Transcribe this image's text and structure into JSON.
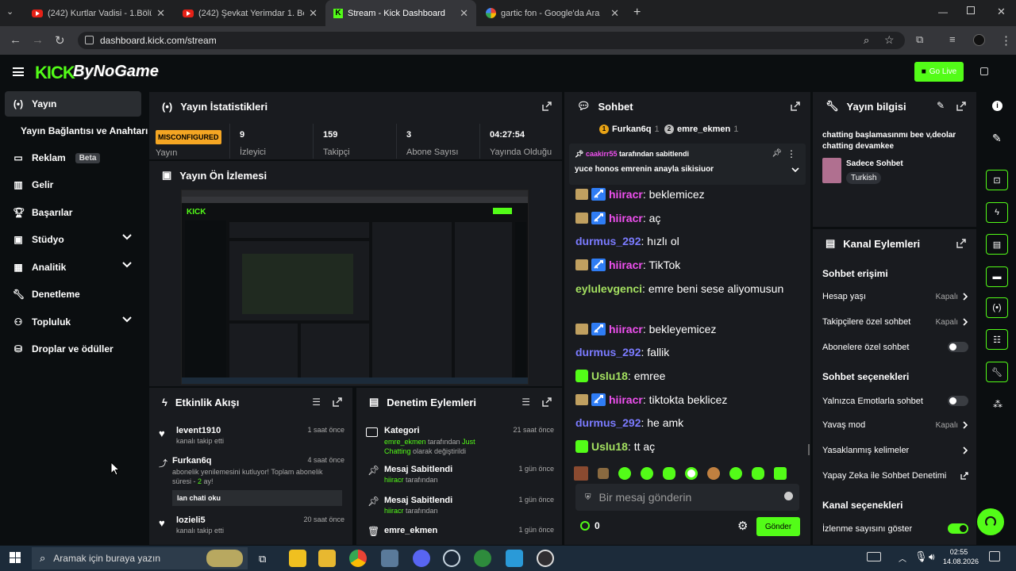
{
  "browser": {
    "tabs": [
      {
        "title": "(242) Kurtlar Vadisi - 1.Bölüm /",
        "icon": "youtube-icon"
      },
      {
        "title": "(242) Şevkat Yerimdar 1. Bölüm",
        "icon": "youtube-icon"
      },
      {
        "title": "Stream - Kick Dashboard",
        "icon": "kick-icon"
      },
      {
        "title": "gartic fon - Google'da Ara",
        "icon": "google-icon"
      }
    ],
    "url": "dashboard.kick.com/stream"
  },
  "header": {
    "logo": "KICK",
    "channel_logo_text": "ByNoGame",
    "go_live": "Go Live"
  },
  "sidebar": {
    "items": [
      {
        "label": "Yayın",
        "icon": "broadcast-icon"
      },
      {
        "label": "Yayın Bağlantısı ve Anahtarı",
        "icon": ""
      },
      {
        "label": "Reklam",
        "icon": "ad-icon",
        "badge": "Beta"
      },
      {
        "label": "Gelir",
        "icon": "revenue-icon"
      },
      {
        "label": "Başarılar",
        "icon": "trophy-icon"
      },
      {
        "label": "Stüdyo",
        "icon": "studio-icon"
      },
      {
        "label": "Analitik",
        "icon": "analytics-icon"
      },
      {
        "label": "Denetleme",
        "icon": "wrench-icon"
      },
      {
        "label": "Topluluk",
        "icon": "community-icon"
      },
      {
        "label": "Droplar ve ödüller",
        "icon": "drops-icon"
      }
    ]
  },
  "stats": {
    "title": "Yayın İstatistikleri",
    "status": "MISCONFIGURED",
    "status_label": "Yayın",
    "cells": [
      {
        "value": "9",
        "label": "İzleyici"
      },
      {
        "value": "159",
        "label": "Takipçi"
      },
      {
        "value": "3",
        "label": "Abone Sayısı"
      },
      {
        "value": "04:27:54",
        "label": "Yayında Olduğu"
      }
    ]
  },
  "preview": {
    "title": "Yayın Ön İzlemesi"
  },
  "activity": {
    "title": "Etkinlik Akışı",
    "items": [
      {
        "name": "levent1910",
        "text": "kanalı takip etti",
        "time": "1 saat önce"
      },
      {
        "name": "Furkan6q",
        "text": "abonelik yenilemesini kutluyor! Toplam abonelik süresi - ",
        "months": "2",
        "months_suffix": " ay!",
        "time": "4 saat önce",
        "message": "lan chati oku"
      },
      {
        "name": "lozieli5",
        "text": "kanalı takip etti",
        "time": "20 saat önce"
      }
    ]
  },
  "moderation": {
    "title": "Denetim Eylemleri",
    "items": [
      {
        "title": "Kategori",
        "user": "emre_ekmen",
        "mid": " tarafından ",
        "cat": "Just Chatting",
        "tail": " olarak değiştirildi",
        "time": "21 saat önce"
      },
      {
        "title": "Mesaj Sabitlendi",
        "user": "hiiracr",
        "mid": " tarafından",
        "time": "1 gün önce"
      },
      {
        "title": "Mesaj Sabitlendi",
        "user": "hiiracr",
        "mid": " tarafından",
        "time": "1 gün önce"
      },
      {
        "title": "emre_ekmen",
        "time": "1 gün önce"
      }
    ]
  },
  "chat": {
    "title": "Sohbet",
    "top_gifters": [
      {
        "rank": "1",
        "name": "Furkan6q",
        "count": "1"
      },
      {
        "rank": "2",
        "name": "emre_ekmen",
        "count": "1"
      }
    ],
    "pinned": {
      "by": "caakirr55",
      "by_suffix": " tarafından sabitlendi",
      "text": "yuce honos emrenin anayla sikisiuor"
    },
    "messages": [
      {
        "user": "hiiracr",
        "text": "beklemicez",
        "color": "#f050f0",
        "badges": "mod"
      },
      {
        "user": "hiiracr",
        "text": "aç",
        "color": "#f050f0",
        "badges": "mod"
      },
      {
        "user": "durmus_292",
        "text": "hızlı ol",
        "color": "#7b7bff",
        "badges": ""
      },
      {
        "user": "hiiracr",
        "text": "TikTok",
        "color": "#f050f0",
        "badges": "mod"
      },
      {
        "user": "eylulevgenci",
        "text": "emre beni sese aliyomusun",
        "color": "#a4e060",
        "badges": ""
      },
      {
        "user": "hiiracr",
        "text": "bekleyemicez",
        "color": "#f050f0",
        "badges": "mod"
      },
      {
        "user": "durmus_292",
        "text": "fallik",
        "color": "#7b7bff",
        "badges": ""
      },
      {
        "user": "Uslu18",
        "text": "emree",
        "color": "#a4e060",
        "badges": "gift"
      },
      {
        "user": "hiiracr",
        "text": "tiktokta beklicez",
        "color": "#f050f0",
        "badges": "mod"
      },
      {
        "user": "durmus_292",
        "text": "he amk",
        "color": "#7b7bff",
        "badges": ""
      },
      {
        "user": "Uslu18",
        "text": "tt aç",
        "color": "#a4e060",
        "badges": "gift"
      }
    ],
    "input_placeholder": "Bir mesaj gönderin",
    "points": "0",
    "send": "Gönder"
  },
  "stream_info": {
    "title": "Yayın bilgisi",
    "stream_title": "chatting başlamasınmı bee v,deolar chatting devamkee",
    "category": "Sadece Sohbet",
    "language": "Turkish"
  },
  "channel_actions": {
    "title": "Kanal Eylemleri",
    "sections": {
      "chat_access": "Sohbet erişimi",
      "chat_options": "Sohbet seçenekleri",
      "channel_options": "Kanal seçenekleri"
    },
    "rows": {
      "account_age": {
        "label": "Hesap yaşı",
        "value": "Kapalı"
      },
      "followers_only": {
        "label": "Takipçilere özel sohbet",
        "value": "Kapalı"
      },
      "subs_only": {
        "label": "Abonelere özel sohbet"
      },
      "emotes_only": {
        "label": "Yalnızca Emotlarla sohbet"
      },
      "slow_mode": {
        "label": "Yavaş mod",
        "value": "Kapalı"
      },
      "banned_words": {
        "label": "Yasaklanmış kelimeler"
      },
      "ai_mod": {
        "label": "Yapay Zeka ile Sohbet Denetimi"
      },
      "show_viewers": {
        "label": "İzlenme sayısını göster"
      }
    }
  },
  "taskbar": {
    "search_placeholder": "Aramak için buraya yazın",
    "time": "02:55",
    "date": "14.08.2026"
  },
  "colors": {
    "accent": "#53fc18",
    "panel": "#191b1f",
    "bg": "#0b0e10",
    "misconfigured": "#f5a623"
  }
}
